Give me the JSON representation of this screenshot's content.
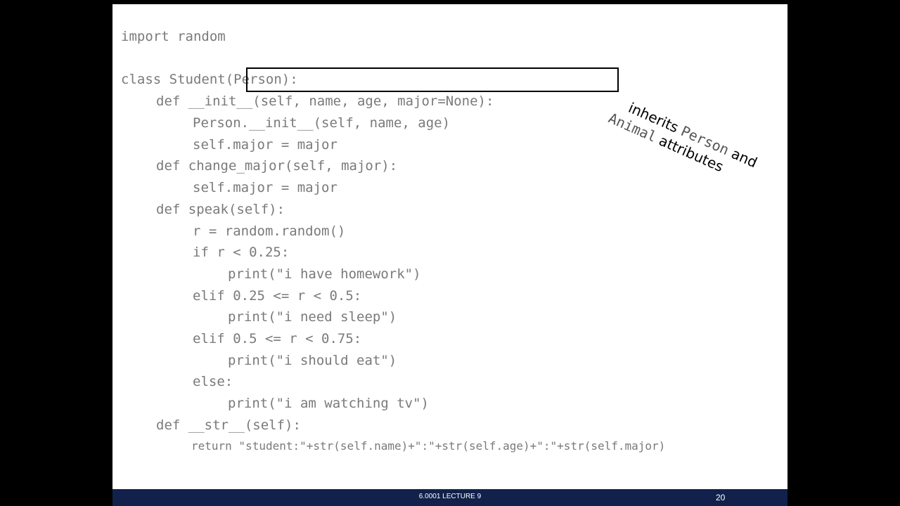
{
  "code": {
    "lines": [
      "import random",
      "class Student(Person):",
      "def __init__(self, name, age, major=None):",
      "Person.__init__(self, name, age)",
      "self.major = major",
      "def change_major(self, major):",
      "self.major = major",
      "def speak(self):",
      "r = random.random()",
      "if r < 0.25:",
      "print(\"i have homework\")",
      "elif 0.25 <= r < 0.5:",
      "print(\"i need sleep\")",
      "elif 0.5 <= r < 0.75:",
      "print(\"i should eat\")",
      "else:",
      "print(\"i am watching tv\")",
      "def __str__(self):",
      "return \"student:\"+str(self.name)+\":\"+str(self.age)+\":\"+str(self.major)"
    ]
  },
  "annotation": {
    "word1": "inherits",
    "person": "Person",
    "and": "and",
    "animal": "Animal",
    "attributes": "attributes"
  },
  "footer": {
    "title": "6.0001 LECTURE 9",
    "page_number": "20",
    "color": "#11214b"
  }
}
